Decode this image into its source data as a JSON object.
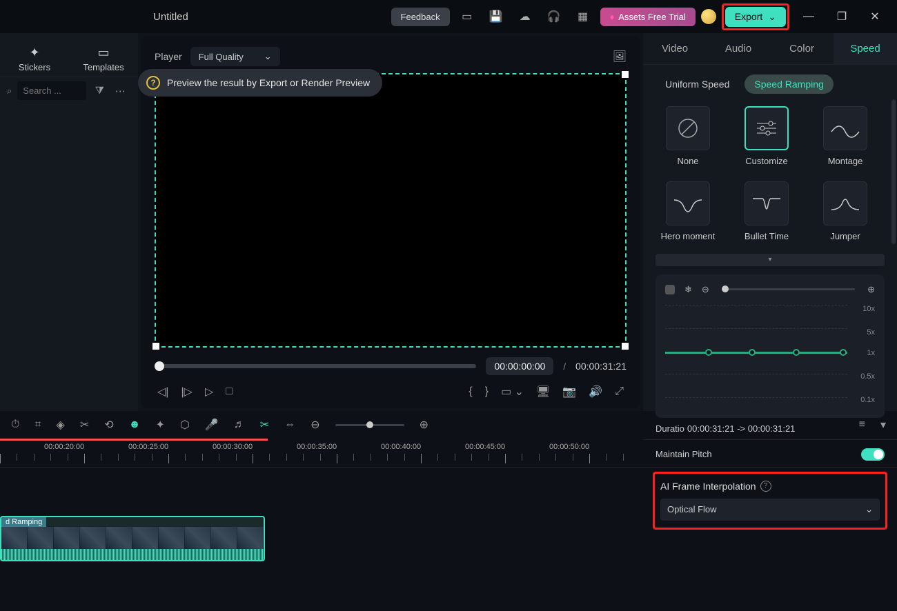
{
  "titlebar": {
    "title": "Untitled",
    "feedback": "Feedback",
    "assets": "Assets Free Trial",
    "export": "Export"
  },
  "left": {
    "stickers": "Stickers",
    "templates": "Templates",
    "search_placeholder": "Search ..."
  },
  "player": {
    "label": "Player",
    "quality": "Full Quality",
    "hint": "Preview the result by Export or Render Preview",
    "current": "00:00:00:00",
    "sep": "/",
    "total": "00:00:31:21"
  },
  "right": {
    "tabs": {
      "video": "Video",
      "audio": "Audio",
      "color": "Color",
      "speed": "Speed"
    },
    "speed_tabs": {
      "uniform": "Uniform Speed",
      "ramping": "Speed Ramping"
    },
    "presets": {
      "none": "None",
      "customize": "Customize",
      "montage": "Montage",
      "hero": "Hero moment",
      "bullet": "Bullet Time",
      "jumper": "Jumper"
    },
    "ramp_labels": {
      "y10": "10x",
      "y5": "5x",
      "y1": "1x",
      "y05": "0.5x",
      "y01": "0.1x"
    },
    "duration_label": "Duratio",
    "duration_value": "00:00:31:21 -> 00:00:31:21",
    "maintain_pitch": "Maintain Pitch",
    "ai_label": "AI Frame Interpolation",
    "ai_value": "Optical Flow"
  },
  "timeline": {
    "ticks": [
      "00:00:20:00",
      "00:00:25:00",
      "00:00:30:00",
      "00:00:35:00",
      "00:00:40:00",
      "00:00:45:00",
      "00:00:50:00"
    ],
    "clip_label": "d Ramping"
  }
}
